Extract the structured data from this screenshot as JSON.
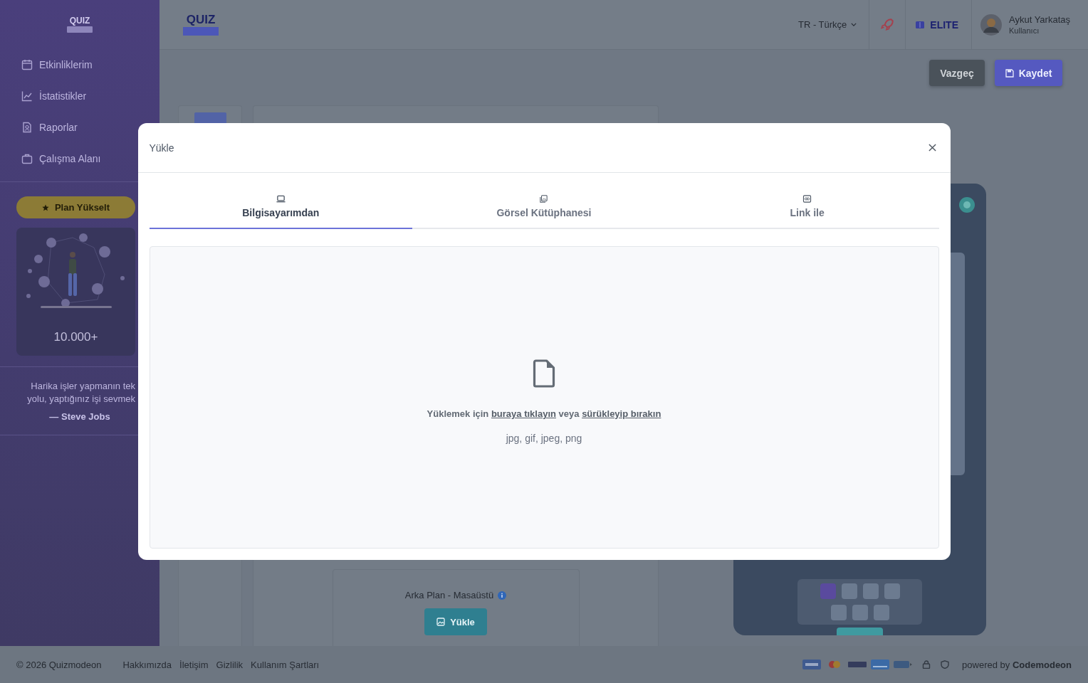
{
  "sidebar": {
    "logo": "QUIZ",
    "items": [
      {
        "label": "Etkinliklerim",
        "kind": "calendar"
      },
      {
        "label": "İstatistikler",
        "kind": "chart"
      },
      {
        "label": "Raporlar",
        "kind": "report"
      },
      {
        "label": "Çalışma Alanı",
        "kind": "briefcase"
      }
    ],
    "upgrade_button": "Plan Yükselt",
    "promo_count": "10.000+",
    "quote": {
      "lines": [
        "Harika işler yapmanın tek",
        "yolu, yaptığınız işi sevmek"
      ],
      "author": "— Steve Jobs"
    }
  },
  "header": {
    "logo": "QUIZ",
    "language": "TR - Türkçe",
    "plan": "ELITE",
    "user": {
      "name": "Aykut Yarkataş",
      "role": "Kullanıcı"
    }
  },
  "actions": [
    {
      "label": "Vazgeç",
      "kind": "cancel"
    },
    {
      "label": "Kaydet",
      "kind": "save"
    }
  ],
  "editor": {
    "background_label": "Arka Plan - Masaüstü",
    "upload_button": "Yükle"
  },
  "preview": {
    "pages": [
      {
        "selected": true
      },
      {
        "selected": false
      },
      {
        "selected": false
      },
      {
        "selected": false
      },
      {
        "selected": false
      },
      {
        "selected": false
      },
      {
        "selected": false
      }
    ]
  },
  "footer": {
    "copyright": "© 2026 Quizmodeon",
    "links": [
      "Hakkımızda",
      "İletişim",
      "Gizlilik",
      "Kullanım Şartları"
    ],
    "powered_by": "powered by **Codemodeon**"
  },
  "modal": {
    "title": "Yükle",
    "tabs": [
      {
        "label": "Bilgisayarımdan",
        "kind": "computer",
        "selected": true
      },
      {
        "label": "Görsel Kütüphanesi",
        "kind": "library",
        "selected": false
      },
      {
        "label": "Link ile",
        "kind": "link",
        "selected": false
      }
    ],
    "drop_zone": {
      "prompt_start": "Yüklemek için",
      "click_link": "buraya tıklayın",
      "prompt_middle": "veya",
      "drag_link": "sürükleyip bırakın",
      "formats": "jpg, gif, jpeg, png"
    }
  }
}
